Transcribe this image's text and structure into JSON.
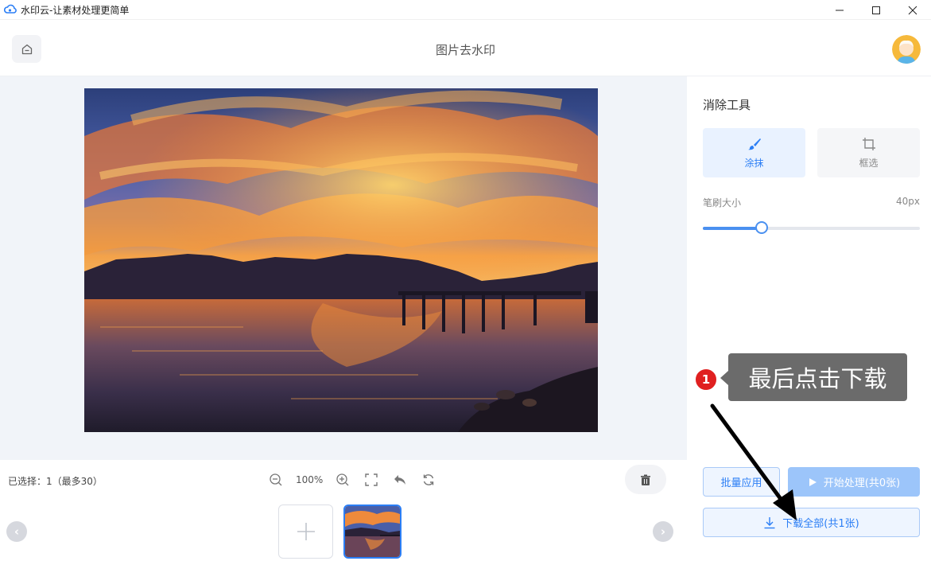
{
  "window": {
    "title": "水印云-让素材处理更简单",
    "controls": [
      "minimize-icon",
      "maximize-icon",
      "close-icon"
    ]
  },
  "header": {
    "page_title": "图片去水印",
    "home_icon": "home-icon"
  },
  "toolbar": {
    "selected_text": "已选择：1（最多30）",
    "zoom_label": "100%"
  },
  "right_panel": {
    "title": "消除工具",
    "tools": [
      {
        "label": "涂抹",
        "icon": "brush-icon",
        "active": true
      },
      {
        "label": "框选",
        "icon": "crop-icon",
        "active": false
      }
    ],
    "brush_size_label": "笔刷大小",
    "brush_size_value": "40px",
    "brush_level_fraction": 0.27,
    "batch_apply_label": "批量应用",
    "start_label": "开始处理(共0张)",
    "download_label": "下载全部(共1张)"
  },
  "annotation": {
    "step_number": "1",
    "callout_text": "最后点击下载"
  },
  "colors": {
    "accent": "#2b7ef5",
    "start_button": "#9cc5fa",
    "badge": "#e02020",
    "callout": "#6b6b6b"
  }
}
